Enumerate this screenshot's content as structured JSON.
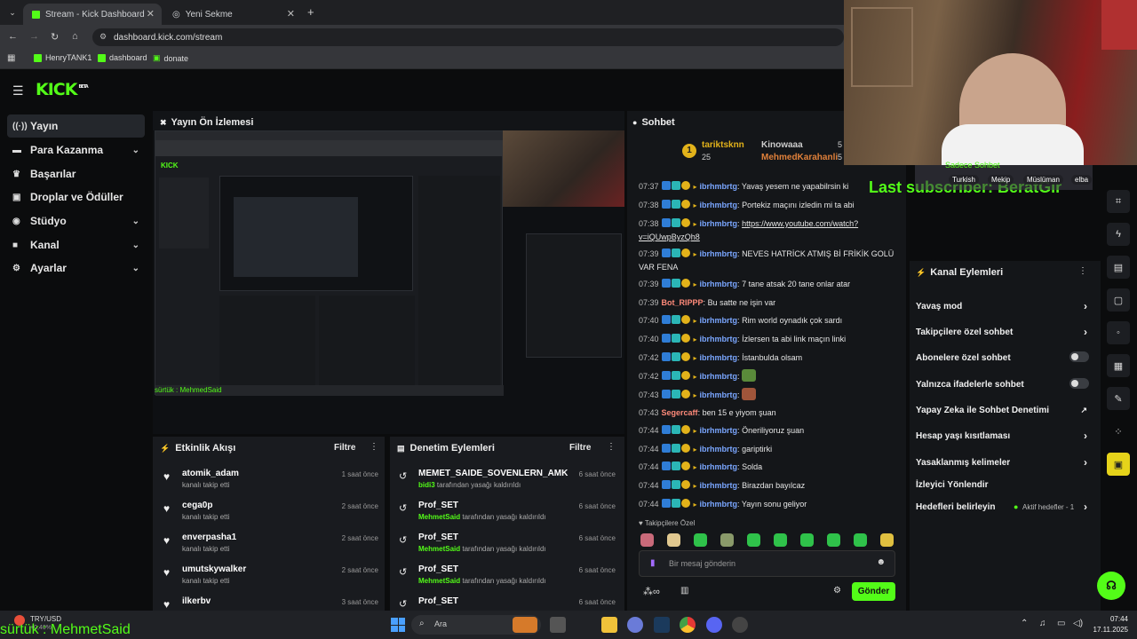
{
  "browser": {
    "tabs": [
      {
        "label": "Stream - Kick Dashboard",
        "active": true
      },
      {
        "label": "Yeni Sekme",
        "active": false
      }
    ],
    "url": "dashboard.kick.com/stream",
    "bookmarks": [
      "HenryTANK1",
      "dashboard",
      "donate"
    ]
  },
  "app": {
    "logo": "KICK",
    "logo_sup": "BETA",
    "sidebar": [
      {
        "label": "Yayın",
        "icon": "broadcast-icon",
        "chevron": false,
        "active": true
      },
      {
        "label": "Para Kazanma",
        "icon": "money-icon",
        "chevron": true
      },
      {
        "label": "Başarılar",
        "icon": "trophy-icon",
        "chevron": false
      },
      {
        "label": "Droplar ve Ödüller",
        "icon": "gift-icon",
        "chevron": false
      },
      {
        "label": "Stüdyo",
        "icon": "studio-icon",
        "chevron": true
      },
      {
        "label": "Kanal",
        "icon": "channel-icon",
        "chevron": true
      },
      {
        "label": "Ayarlar",
        "icon": "gear-icon",
        "chevron": true
      }
    ],
    "preview": {
      "title": "Yayın Ön İzlemesi",
      "caption": "sürtük : MehmedSaid"
    },
    "activity": {
      "title": "Etkinlik Akışı",
      "filter": "Filtre",
      "items": [
        {
          "name": "atomik_adam",
          "sub": "kanalı takip etti",
          "time": "1 saat önce"
        },
        {
          "name": "cega0p",
          "sub": "kanalı takip etti",
          "time": "2 saat önce"
        },
        {
          "name": "enverpasha1",
          "sub": "kanalı takip etti",
          "time": "2 saat önce"
        },
        {
          "name": "umutskywalker",
          "sub": "kanalı takip etti",
          "time": "2 saat önce"
        },
        {
          "name": "ilkerbv",
          "sub": "",
          "time": "3 saat önce"
        }
      ]
    },
    "moderation": {
      "title": "Denetim Eylemleri",
      "filter": "Filtre",
      "items": [
        {
          "name": "MEMET_SAIDE_SOVENLERN_AMK",
          "actor": "bidi3",
          "sub": "tarafından yasağı kaldırıldı",
          "time": "6 saat önce"
        },
        {
          "name": "Prof_SET",
          "actor": "MehmetSaid",
          "sub": "tarafından yasağı kaldırıldı",
          "time": "6 saat önce"
        },
        {
          "name": "Prof_SET",
          "actor": "MehmetSaid",
          "sub": "tarafından yasağı kaldırıldı",
          "time": "6 saat önce"
        },
        {
          "name": "Prof_SET",
          "actor": "MehmetSaid",
          "sub": "tarafından yasağı kaldırıldı",
          "time": "6 saat önce"
        },
        {
          "name": "Prof_SET",
          "actor": "",
          "sub": "",
          "time": "6 saat önce"
        }
      ]
    },
    "chat": {
      "title": "Sohbet",
      "top": {
        "rank": "1",
        "name": "tariktsknn",
        "count": "25",
        "second": "Kinowaaa",
        "third": "MehmedKarahanli",
        "n2": "5",
        "n3": "5"
      },
      "messages": [
        {
          "time": "07:37",
          "user": "ibrhmbrtg",
          "text": "Yavaş yesem ne yapabilrsin ki"
        },
        {
          "time": "07:38",
          "user": "ibrhmbrtg",
          "text": "Portekiz maçını izledin mi ta abi"
        },
        {
          "time": "07:38",
          "user": "ibrhmbrtg",
          "text": "https://www.youtube.com/watch?v=iQUwpByzQh8"
        },
        {
          "time": "07:39",
          "user": "ibrhmbrtg",
          "text": "NEVES HATRİCK ATMIŞ Bİ FRİKİK GOLÜ VAR FENA"
        },
        {
          "time": "07:39",
          "user": "ibrhmbrtg",
          "text": "7 tane atsak 20 tane onlar atar"
        },
        {
          "time": "07:39",
          "user": "Bot_RIPPP",
          "text": "Bu satte ne işin var"
        },
        {
          "time": "07:40",
          "user": "ibrhmbrtg",
          "text": "Rim world oynadık çok sardı"
        },
        {
          "time": "07:40",
          "user": "ibrhmbrtg",
          "text": "İzlersen ta abi link maçın linki"
        },
        {
          "time": "07:42",
          "user": "ibrhmbrtg",
          "text": "İstanbulda olsam"
        },
        {
          "time": "07:42",
          "user": "ibrhmbrtg",
          "text": ""
        },
        {
          "time": "07:43",
          "user": "ibrhmbrtg",
          "text": ""
        },
        {
          "time": "07:43",
          "user": "Segercaff",
          "text": "ben 15 e yiyom şuan"
        },
        {
          "time": "07:44",
          "user": "ibrhmbrtg",
          "text": "Öneriliyoruz şuan"
        },
        {
          "time": "07:44",
          "user": "ibrhmbrtg",
          "text": "gariptirki"
        },
        {
          "time": "07:44",
          "user": "ibrhmbrtg",
          "text": "Solda"
        },
        {
          "time": "07:44",
          "user": "ibrhmbrtg",
          "text": "Birazdan bayılcaz"
        },
        {
          "time": "07:44",
          "user": "ibrhmbrtg",
          "text": "Yayın sonu geliyor"
        }
      ],
      "emote_header": "Takipçilere Özel",
      "placeholder": "Bir mesaj gönderin",
      "send": "Gönder"
    },
    "channel_actions": {
      "title": "Kanal Eylemleri",
      "items": [
        {
          "label": "Yavaş mod",
          "kind": "chevron"
        },
        {
          "label": "Takipçilere özel sohbet",
          "kind": "chevron"
        },
        {
          "label": "Abonelere özel sohbet",
          "kind": "toggle"
        },
        {
          "label": "Yalnızca ifadelerle sohbet",
          "kind": "toggle"
        },
        {
          "label": "Yapay Zeka ile Sohbet Denetimi",
          "kind": "external"
        },
        {
          "label": "Hesap yaşı kısıtlaması",
          "kind": "chevron"
        },
        {
          "label": "Yasaklanmış kelimeler",
          "kind": "chevron"
        },
        {
          "label": "İzleyici Yönlendir",
          "kind": "none"
        },
        {
          "label": "Hedefleri belirleyin",
          "kind": "goal"
        }
      ],
      "goal_status": "Aktif hedefler - 1"
    },
    "overlay": {
      "last_sub": "Last subscriber: BeratGir",
      "sadece": "Sadece Sohbet",
      "chips": [
        "Turkish",
        "Mekip",
        "Müslüman",
        "elba"
      ]
    }
  },
  "taskbar": {
    "ticker": "TRY/USD",
    "ticker_sub": "+0,40%",
    "overlay_caption": "sürtük : MehmetSaid",
    "search": "Ara",
    "clock": "07:44",
    "date": "17.11.2025"
  }
}
